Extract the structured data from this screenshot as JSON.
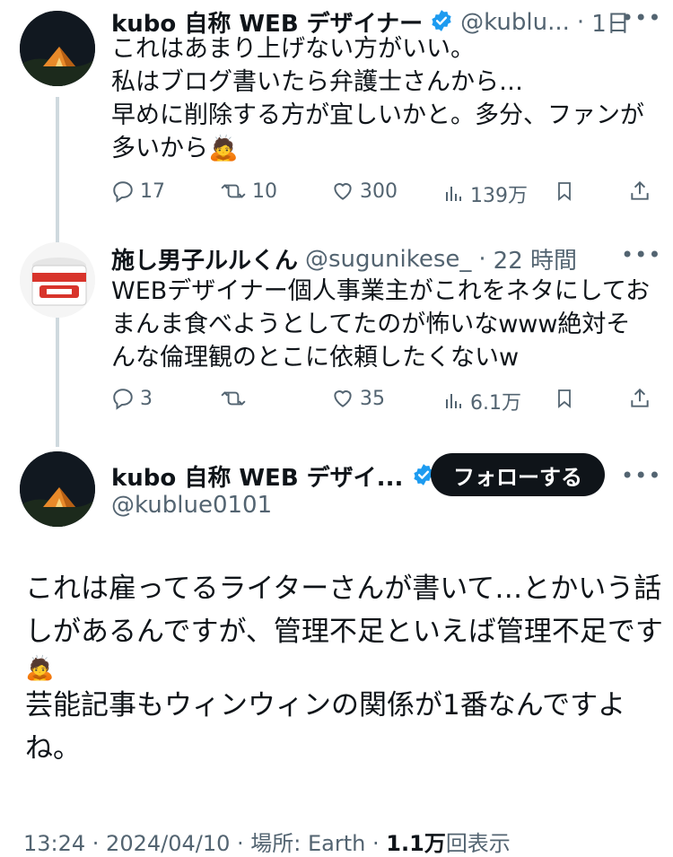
{
  "tweet1": {
    "name": "kubo 自称 WEB デザイナー",
    "handle": "@kublu...",
    "sep": "·",
    "time": "1日",
    "lines": [
      "これはあまり上げない方がいい。",
      "私はブログ書いたら弁護士さんから…",
      "早めに削除する方が宜しいかと。多分、ファンが",
      "多いから"
    ],
    "emoji": "🙇",
    "replies": "17",
    "retweets": "10",
    "likes": "300",
    "views": "139万"
  },
  "tweet2": {
    "name": "施し男子ルルくん",
    "handle": "@sugunikese_",
    "sep": "·",
    "time": "22 時間",
    "lines": [
      "WEBデザイナー個人事業主がこれをネタにしてお",
      "まんま食べようとしてたのが怖いなwww絶対そ",
      "んな倫理観のとこに依頼したくないw"
    ],
    "replies": "3",
    "retweets": "",
    "likes": "35",
    "views": "6.1万"
  },
  "main": {
    "name": "kubo 自称 WEB デザイ...",
    "handle": "@kublue0101",
    "follow_label": "フォローする",
    "lines": [
      "これは雇ってるライターさんが書いて…とかいう話",
      "しがあるんですが、管理不足といえば管理不足です"
    ],
    "emoji": "🙇",
    "lines2": [
      "芸能記事もウィンウィンの関係が1番なんですよ",
      "ね。"
    ],
    "meta_time": "13:24 · 2024/04/10",
    "meta_place": "場所: Earth",
    "meta_sep": "·",
    "meta_views": "1.1万",
    "meta_views_suffix": "回表示"
  },
  "icons": {
    "reply": "reply-icon",
    "retweet": "retweet-icon",
    "like": "heart-icon",
    "views": "views-icon",
    "bookmark": "bookmark-icon",
    "share": "share-icon",
    "verified": "verified-badge-icon",
    "more": "more-icon"
  },
  "colors": {
    "verified": "#1d9bf0",
    "muted": "#536471",
    "text": "#0f1419",
    "line": "#cfd9de"
  }
}
